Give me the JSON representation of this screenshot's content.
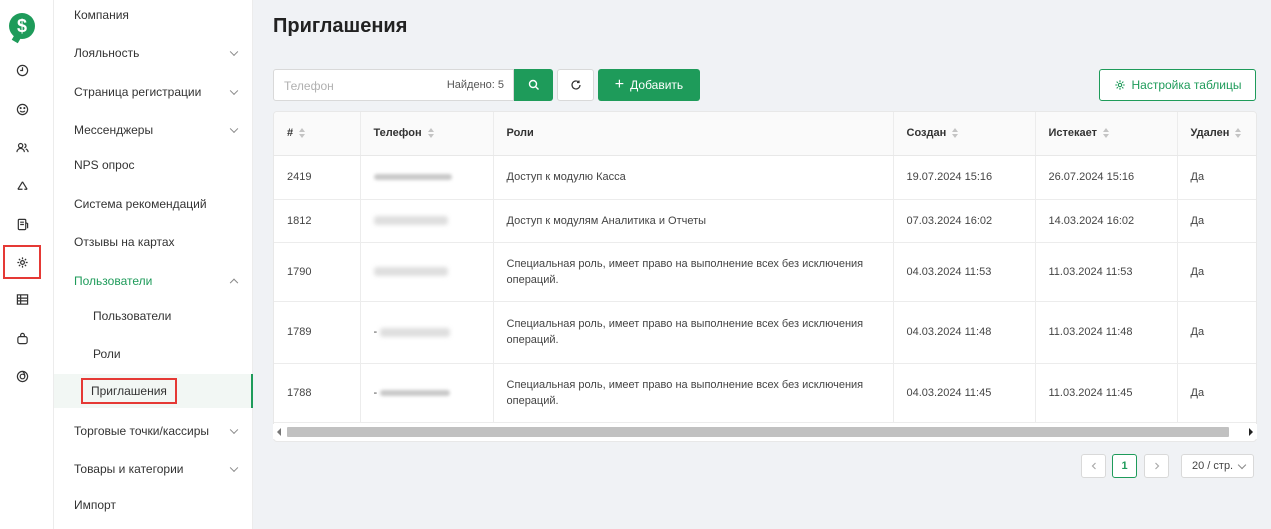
{
  "brand": {
    "logo_glyph": "$",
    "color": "#1e9b5a"
  },
  "rail": [
    "clock-icon",
    "emoji-icon",
    "users-icon",
    "recycle-icon",
    "document-icon",
    "settings-icon",
    "table-icon",
    "bag-icon",
    "spiral-icon"
  ],
  "sidebar": {
    "items": [
      {
        "label": "Компания"
      },
      {
        "label": "Лояльность"
      },
      {
        "label": "Страница регистрации"
      },
      {
        "label": "Мессенджеры"
      },
      {
        "label": "NPS опрос"
      },
      {
        "label": "Система рекомендаций"
      },
      {
        "label": "Отзывы на картах"
      },
      {
        "label": "Пользователи"
      },
      {
        "label": "Пользователи"
      },
      {
        "label": "Роли"
      },
      {
        "label": "Приглашения"
      },
      {
        "label": "Торговые точки/кассиры"
      },
      {
        "label": "Товары и категории"
      },
      {
        "label": "Импорт"
      }
    ]
  },
  "page": {
    "title": "Приглашения"
  },
  "toolbar": {
    "search_placeholder": "Телефон",
    "found_label": "Найдено: 5",
    "add_label": "Добавить",
    "settings_label": "Настройка таблицы"
  },
  "table": {
    "columns": [
      "#",
      "Телефон",
      "Роли",
      "Создан",
      "Истекает",
      "Удален"
    ],
    "rows": [
      {
        "id": "2419",
        "phone": "",
        "role": "Доступ к модулю Касса",
        "created": "19.07.2024 15:16",
        "expires": "26.07.2024 15:16",
        "deleted": "Да"
      },
      {
        "id": "1812",
        "phone": "",
        "role": "Доступ к модулям Аналитика и Отчеты",
        "created": "07.03.2024 16:02",
        "expires": "14.03.2024 16:02",
        "deleted": "Да"
      },
      {
        "id": "1790",
        "phone": "",
        "role": "Специальная роль, имеет право на выполнение всех без исключения операций.",
        "created": "04.03.2024 11:53",
        "expires": "11.03.2024 11:53",
        "deleted": "Да"
      },
      {
        "id": "1789",
        "phone": "-",
        "role": "Специальная роль, имеет право на выполнение всех без исключения операций.",
        "created": "04.03.2024 11:48",
        "expires": "11.03.2024 11:48",
        "deleted": "Да"
      },
      {
        "id": "1788",
        "phone": "-",
        "role": "Специальная роль, имеет право на выполнение всех без исключения операций.",
        "created": "04.03.2024 11:45",
        "expires": "11.03.2024 11:45",
        "deleted": "Да"
      }
    ]
  },
  "pagination": {
    "current": "1",
    "per_page": "20 / стр."
  }
}
